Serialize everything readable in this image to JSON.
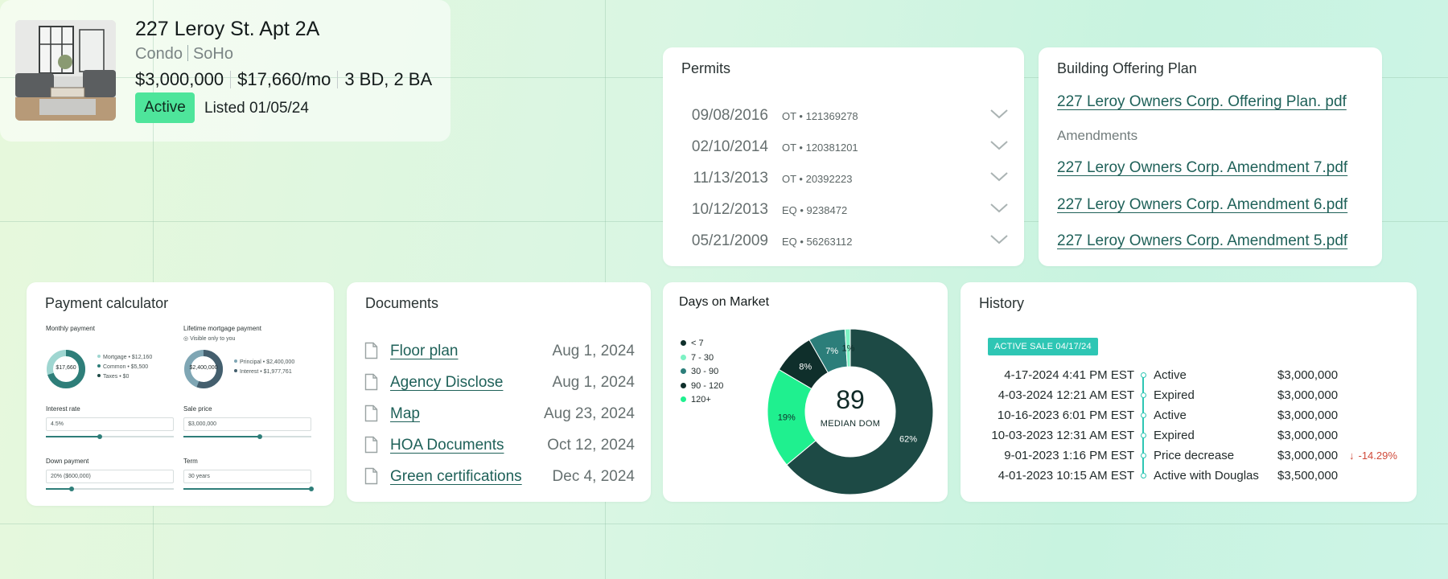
{
  "listing": {
    "address": "227 Leroy St. Apt 2A",
    "type": "Condo",
    "neighborhood": "SoHo",
    "price": "$3,000,000",
    "monthly": "$17,660/mo",
    "beds_baths": "3 BD, 2 BA",
    "status": "Active",
    "listed": "Listed 01/05/24",
    "status_color": "#4ee59b"
  },
  "permits": {
    "title": "Permits",
    "rows": [
      {
        "date": "09/08/2016",
        "code": "OT • 121369278"
      },
      {
        "date": "02/10/2014",
        "code": "OT • 120381201"
      },
      {
        "date": "11/13/2013",
        "code": "OT • 20392223"
      },
      {
        "date": "10/12/2013",
        "code": "EQ • 9238472"
      },
      {
        "date": "05/21/2009",
        "code": "EQ • 56263112"
      }
    ]
  },
  "offering": {
    "title": "Building Offering Plan",
    "plan": "227 Leroy Owners Corp. Offering Plan. pdf",
    "amendments_label": "Amendments",
    "amendments": [
      "227 Leroy Owners Corp. Amendment 7.pdf",
      "227 Leroy Owners Corp. Amendment 6.pdf",
      "227 Leroy Owners Corp. Amendment 5.pdf"
    ]
  },
  "payment": {
    "title": "Payment calculator",
    "monthly_label": "Monthly payment",
    "monthly_value": "$17,660",
    "monthly_legend": [
      "Mortgage • $12,160",
      "Common • $5,500",
      "Taxes • $0"
    ],
    "lifetime_label": "Lifetime mortgage payment",
    "lifetime_note": "Visible only to you",
    "lifetime_value": "$2,400,000",
    "lifetime_legend": [
      "Principal • $2,400,000",
      "Interest • $1,977,761"
    ],
    "interest_label": "Interest rate",
    "interest_value": "4.5%",
    "interest_level": 0.42,
    "sale_label": "Sale price",
    "sale_value": "$3,000,000",
    "sale_level": 0.6,
    "down_label": "Down payment",
    "down_value": "20% ($600,000)",
    "down_level": 0.2,
    "term_label": "Term",
    "term_value": "30 years",
    "term_level": 1.0
  },
  "documents": {
    "title": "Documents",
    "rows": [
      {
        "name": "Floor plan",
        "date": "Aug 1, 2024"
      },
      {
        "name": "Agency Disclose",
        "date": "Aug 1, 2024"
      },
      {
        "name": "Map",
        "date": "Aug 23, 2024"
      },
      {
        "name": "HOA Documents",
        "date": "Oct 12, 2024"
      },
      {
        "name": "Green certifications",
        "date": "Dec 4, 2024"
      }
    ]
  },
  "dom": {
    "title": "Days on Market",
    "median": "89",
    "median_label": "MEDIAN DOM"
  },
  "chart_data": {
    "type": "pie",
    "categories": [
      "< 7",
      "7 - 30",
      "30 - 90",
      "90 - 120",
      "120+"
    ],
    "values": [
      62,
      19,
      8,
      7,
      1
    ],
    "labels": [
      "62%",
      "19%",
      "8%",
      "7%",
      "1%"
    ],
    "colors": [
      "#1d4a45",
      "#1ff08f",
      "#0f2f2b",
      "#2c7e7a",
      "#7df2c4"
    ],
    "legend_colors": [
      "#0f2f2b",
      "#7df2c4",
      "#2c7e7a",
      "#0f2f2b",
      "#1ff08f"
    ],
    "legend": "left"
  },
  "history": {
    "title": "History",
    "badge": "ACTIVE SALE 04/17/24",
    "rows": [
      {
        "date": "4-17-2024 4:41 PM EST",
        "event": "Active",
        "price": "$3,000,000",
        "change": ""
      },
      {
        "date": "4-03-2024 12:21 AM EST",
        "event": "Expired",
        "price": "$3,000,000",
        "change": ""
      },
      {
        "date": "10-16-2023 6:01 PM EST",
        "event": "Active",
        "price": "$3,000,000",
        "change": ""
      },
      {
        "date": "10-03-2023 12:31 AM EST",
        "event": "Expired",
        "price": "$3,000,000",
        "change": ""
      },
      {
        "date": "9-01-2023 1:16 PM EST",
        "event": "Price decrease",
        "price": "$3,000,000",
        "change": "-14.29%"
      },
      {
        "date": "4-01-2023 10:15 AM EST",
        "event": "Active with Douglas",
        "price": "$3,500,000",
        "change": ""
      }
    ]
  }
}
